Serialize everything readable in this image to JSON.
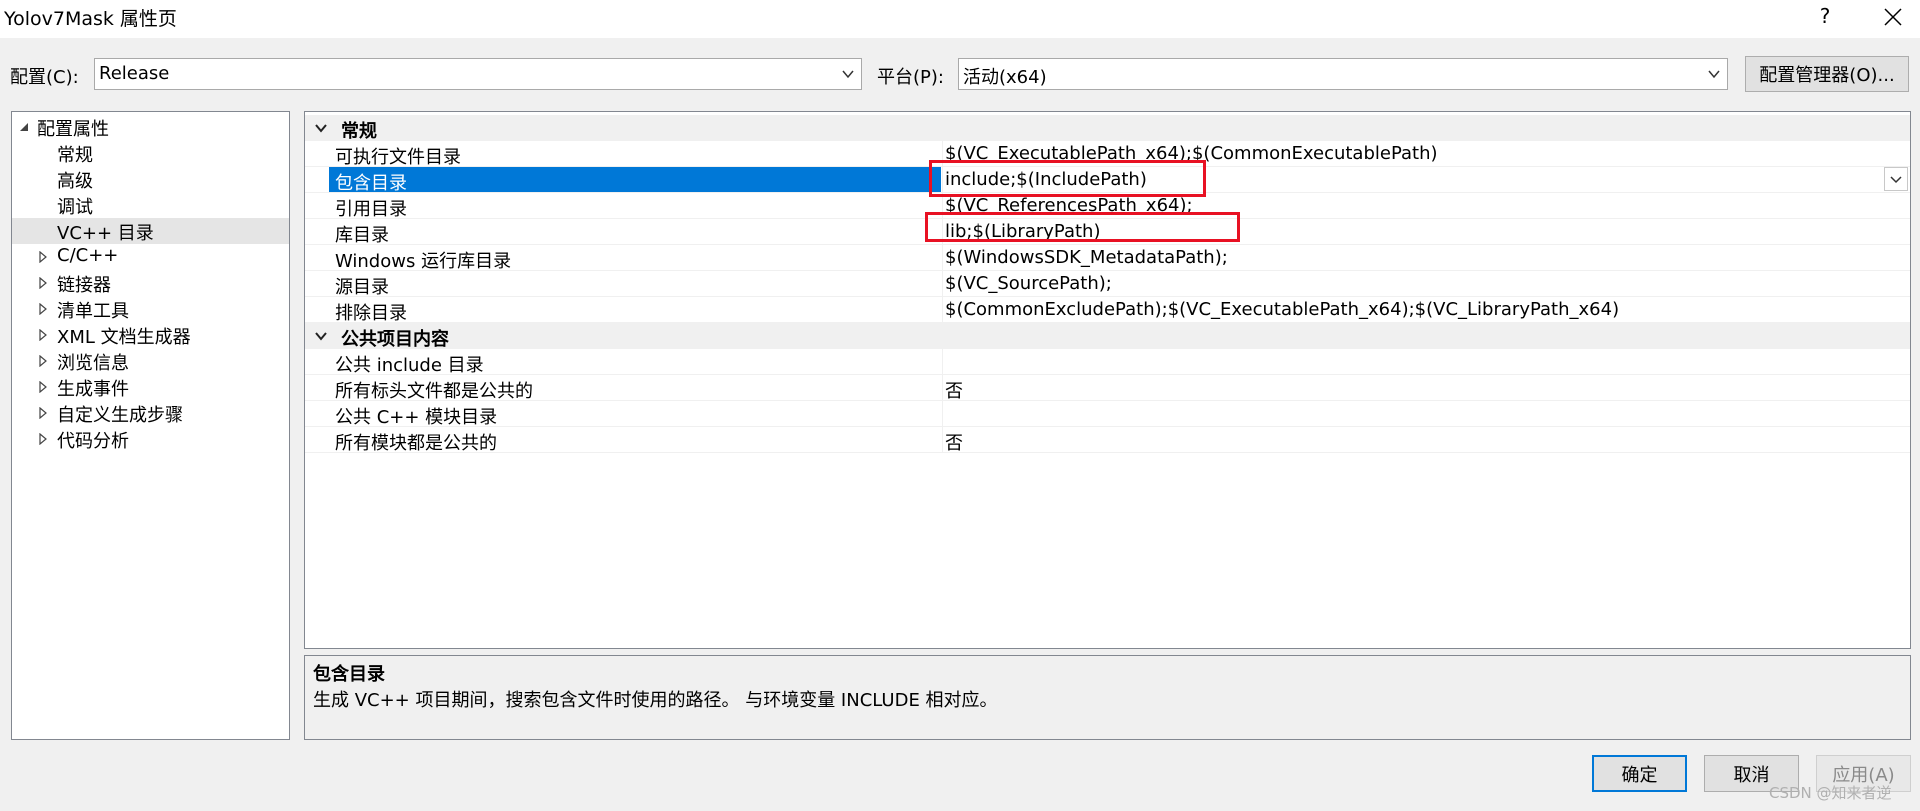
{
  "window": {
    "title": "Yolov7Mask 属性页",
    "help_label": "?"
  },
  "config": {
    "label": "配置(C):",
    "value": "Release",
    "platform_label": "平台(P):",
    "platform_value": "活动(x64)",
    "manager_button": "配置管理器(O)..."
  },
  "tree": {
    "items": [
      {
        "label": "配置属性",
        "expanded": true,
        "level": 0
      },
      {
        "label": "常规",
        "level": 1
      },
      {
        "label": "高级",
        "level": 1
      },
      {
        "label": "调试",
        "level": 1
      },
      {
        "label": "VC++ 目录",
        "level": 1,
        "selected": true
      },
      {
        "label": "C/C++",
        "level": 1,
        "collapsed": true
      },
      {
        "label": "链接器",
        "level": 1,
        "collapsed": true
      },
      {
        "label": "清单工具",
        "level": 1,
        "collapsed": true
      },
      {
        "label": "XML 文档生成器",
        "level": 1,
        "collapsed": true
      },
      {
        "label": "浏览信息",
        "level": 1,
        "collapsed": true
      },
      {
        "label": "生成事件",
        "level": 1,
        "collapsed": true
      },
      {
        "label": "自定义生成步骤",
        "level": 1,
        "collapsed": true
      },
      {
        "label": "代码分析",
        "level": 1,
        "collapsed": true
      }
    ]
  },
  "grid": {
    "categories": [
      {
        "label": "常规",
        "rows": [
          {
            "name": "可执行文件目录",
            "value": "$(VC_ExecutablePath_x64);$(CommonExecutablePath)"
          },
          {
            "name": "包含目录",
            "value": "include;$(IncludePath)",
            "selected": true
          },
          {
            "name": "引用目录",
            "value": "$(VC_ReferencesPath_x64);"
          },
          {
            "name": "库目录",
            "value": "lib;$(LibraryPath)"
          },
          {
            "name": "Windows 运行库目录",
            "value": "$(WindowsSDK_MetadataPath);"
          },
          {
            "name": "源目录",
            "value": "$(VC_SourcePath);"
          },
          {
            "name": "排除目录",
            "value": "$(CommonExcludePath);$(VC_ExecutablePath_x64);$(VC_LibraryPath_x64)"
          }
        ]
      },
      {
        "label": "公共项目内容",
        "rows": [
          {
            "name": "公共 include 目录",
            "value": ""
          },
          {
            "name": "所有标头文件都是公共的",
            "value": "否"
          },
          {
            "name": "公共 C++ 模块目录",
            "value": ""
          },
          {
            "name": "所有模块都是公共的",
            "value": "否"
          }
        ]
      }
    ]
  },
  "description": {
    "title": "包含目录",
    "text": "生成 VC++ 项目期间，搜索包含文件时使用的路径。 与环境变量 INCLUDE 相对应。"
  },
  "buttons": {
    "ok": "确定",
    "cancel": "取消",
    "apply": "应用(A)"
  },
  "watermark": "CSDN @知来者逆",
  "colors": {
    "selection": "#0078d7",
    "highlight_box": "#e81123"
  }
}
